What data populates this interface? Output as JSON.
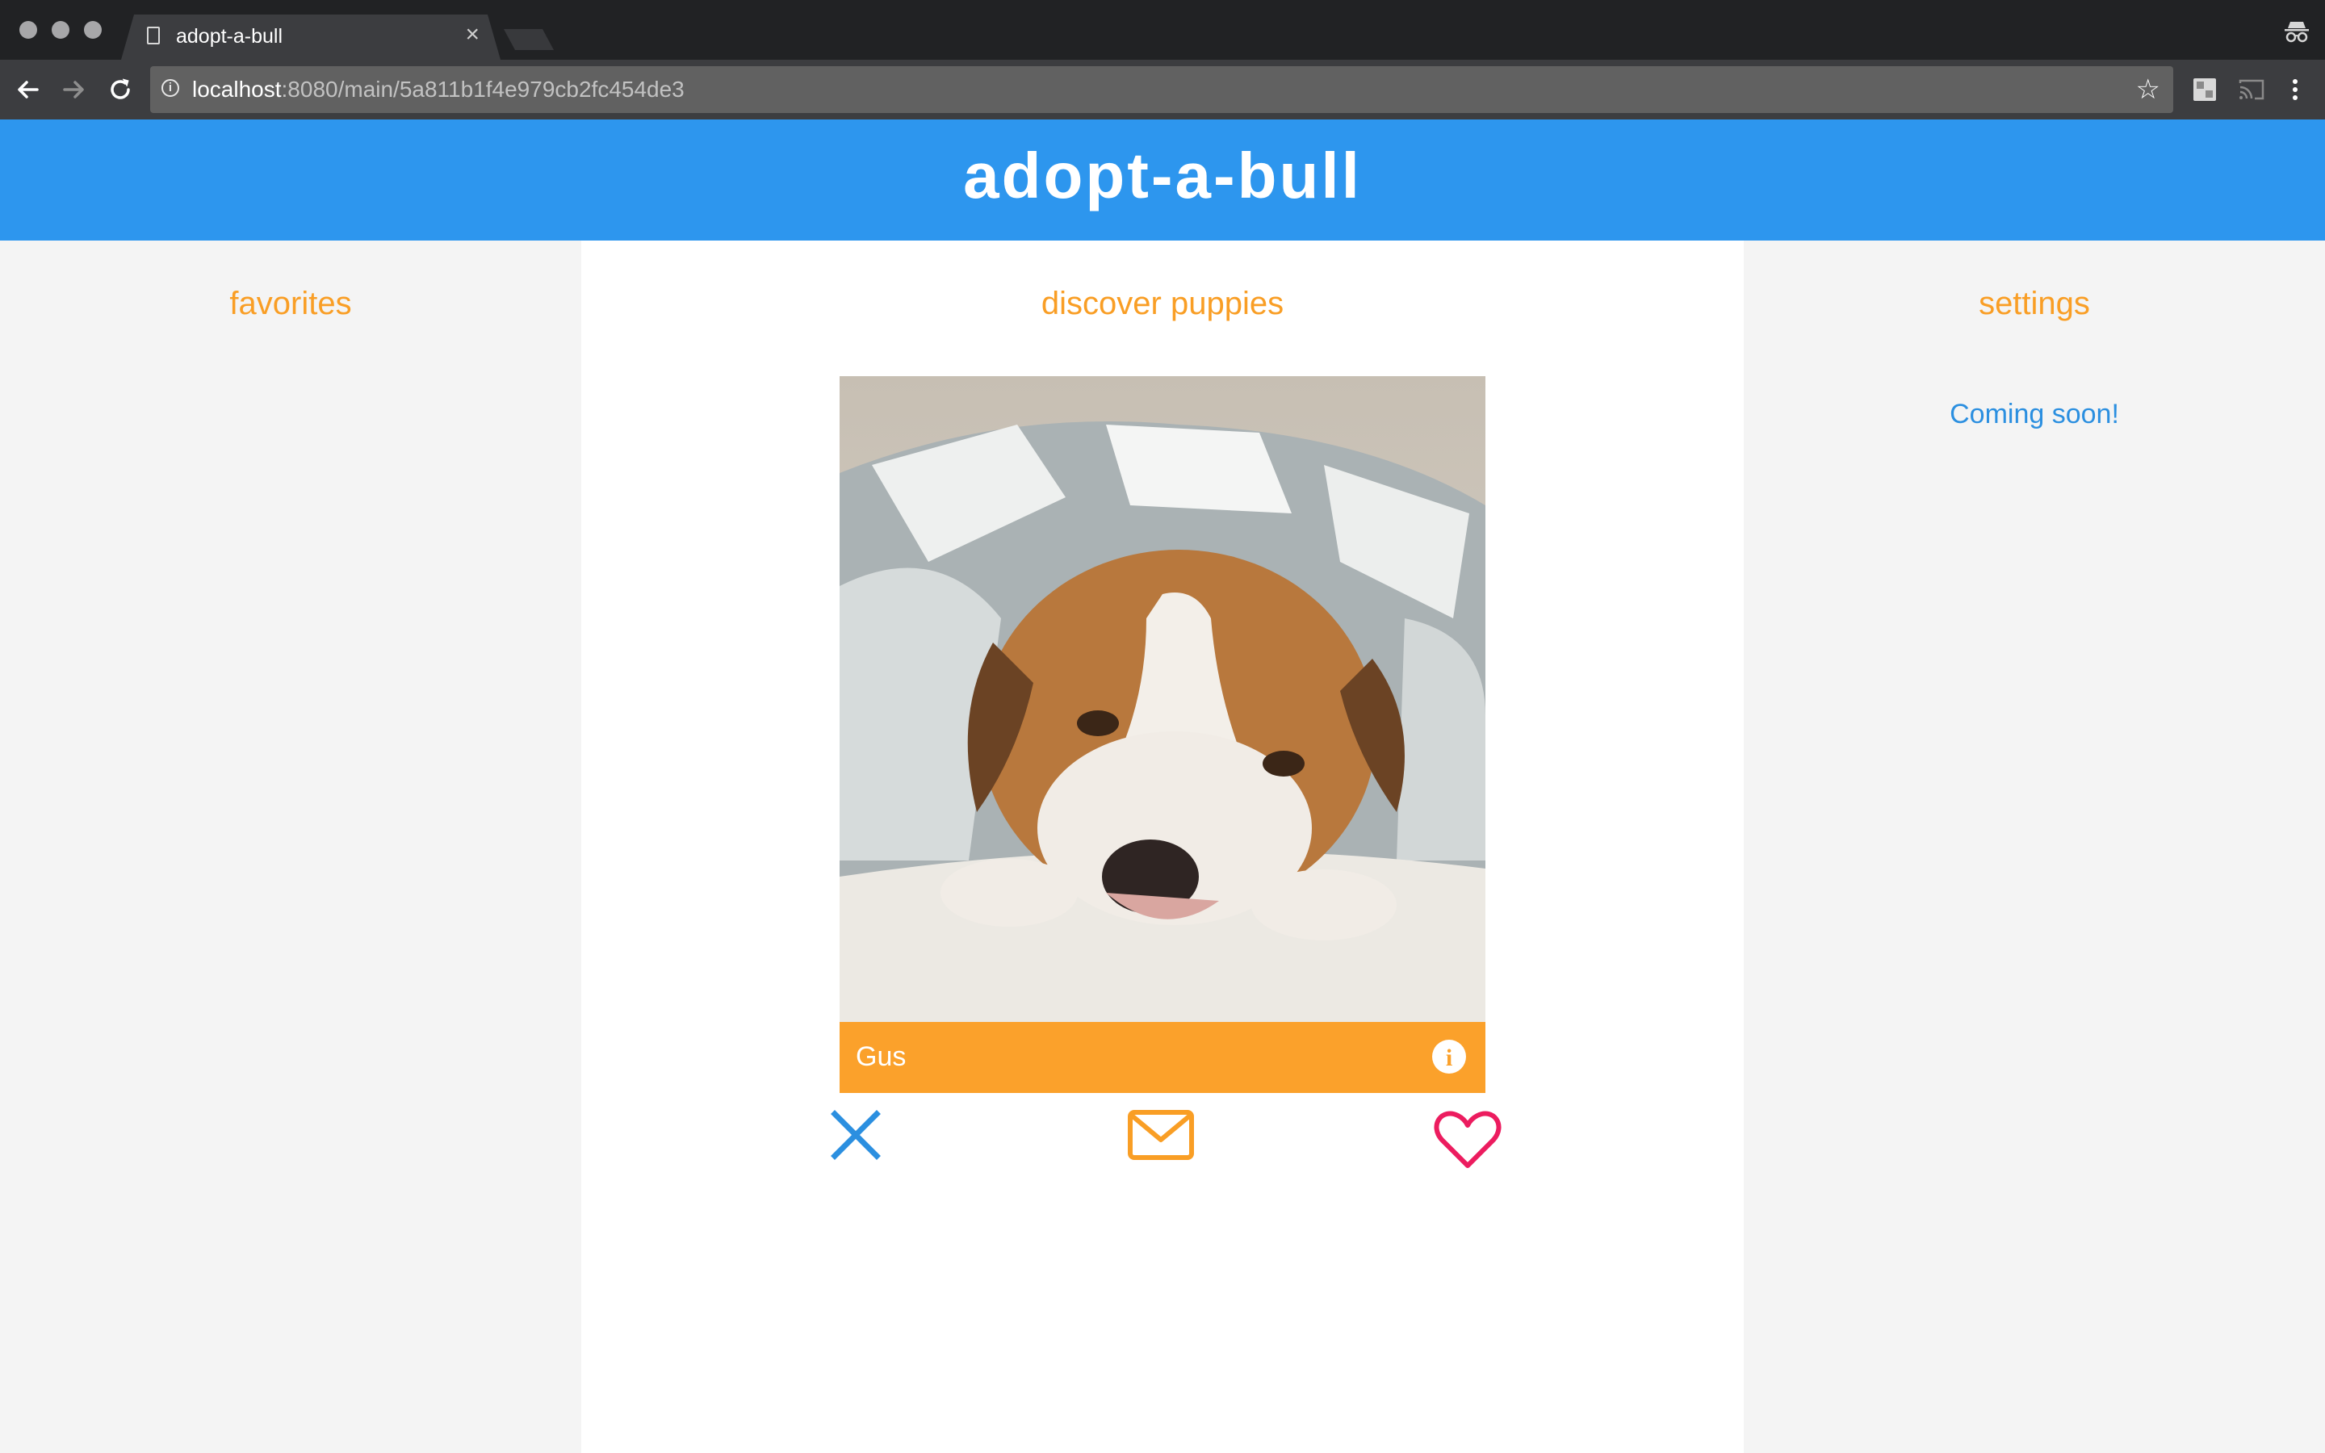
{
  "browser": {
    "tab_title": "adopt-a-bull",
    "tab_close": "×",
    "url_host": "localhost",
    "url_path": ":8080/main/5a811b1f4e979cb2fc454de3",
    "info_glyph": "i",
    "star_glyph": "☆"
  },
  "header": {
    "brand": "adopt-a-bull"
  },
  "left": {
    "heading": "favorites"
  },
  "center": {
    "heading": "discover puppies",
    "card": {
      "name": "Gus",
      "info_glyph": "i",
      "photo_alt": "dog-photo"
    },
    "actions": {
      "reject_icon": "close-icon",
      "message_icon": "mail-icon",
      "like_icon": "heart-icon"
    }
  },
  "right": {
    "heading": "settings",
    "message": "Coming soon!"
  },
  "colors": {
    "header_blue": "#2d96ee",
    "accent_orange": "#f99e25",
    "link_blue": "#2b8fe0",
    "heart_pink": "#ec1c5f"
  }
}
